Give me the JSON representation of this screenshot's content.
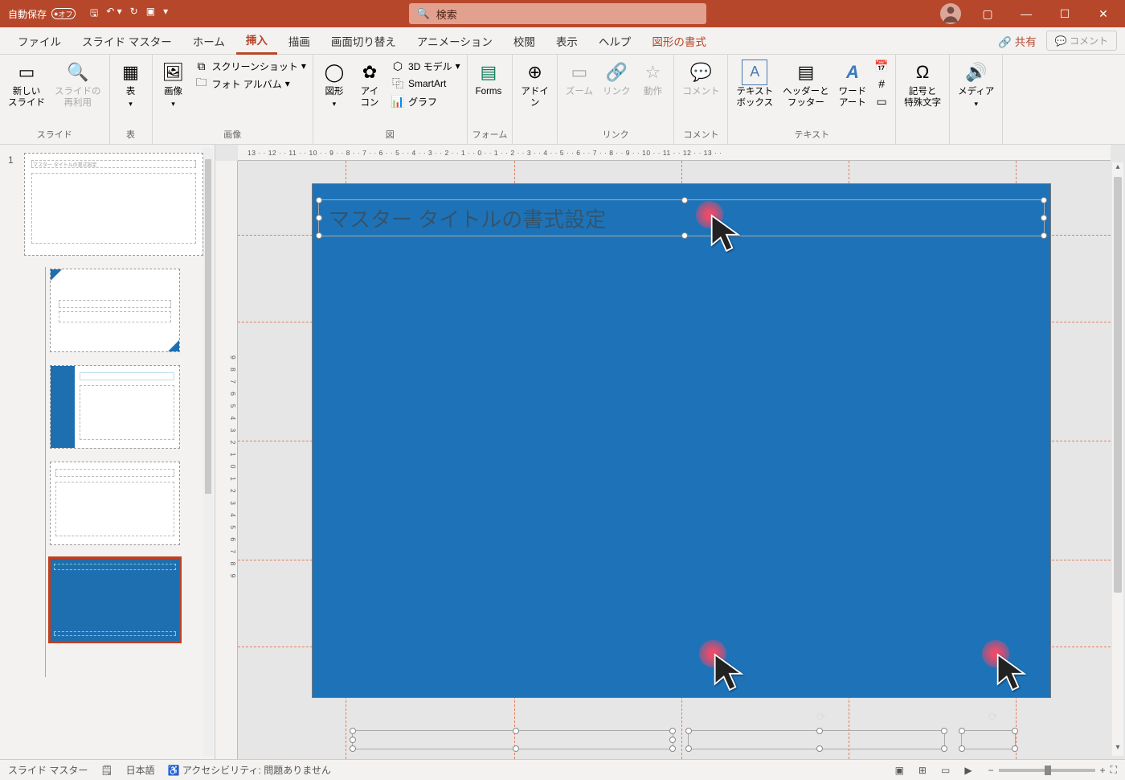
{
  "titlebar": {
    "autosave_label": "自動保存",
    "autosave_state": "オフ",
    "search_placeholder": "検索"
  },
  "tabs": {
    "file": "ファイル",
    "slidemaster": "スライド マスター",
    "home": "ホーム",
    "insert": "挿入",
    "draw": "描画",
    "transitions": "画面切り替え",
    "animations": "アニメーション",
    "review": "校閲",
    "view": "表示",
    "help": "ヘルプ",
    "shapeformat": "図形の書式",
    "share": "共有",
    "comments": "コメント"
  },
  "ribbon": {
    "group_slide": "スライド",
    "new_slide": "新しい\nスライド",
    "reuse_slide": "スライドの\n再利用",
    "group_table": "表",
    "table": "表",
    "group_image": "画像",
    "images": "画像",
    "screenshot": "スクリーンショット",
    "photo_album": "フォト アルバム",
    "group_illust": "図",
    "shapes": "図形",
    "icons": "アイ\nコン",
    "model3d": "3D モデル",
    "smartart": "SmartArt",
    "chart": "グラフ",
    "group_form": "フォーム",
    "forms": "Forms",
    "addin": "アドイ\nン",
    "group_link": "リンク",
    "zoom": "ズーム",
    "link": "リンク",
    "action": "動作",
    "group_comment": "コメント",
    "comment": "コメント",
    "group_text": "テキスト",
    "textbox": "テキスト\nボックス",
    "headerfooter": "ヘッダーと\nフッター",
    "wordart": "ワード\nアート",
    "group_symbol": "記号と\n特殊文字",
    "symbol": "記号と\n特殊文字",
    "group_media": "メディア",
    "media": "メディア"
  },
  "ruler": {
    "horizontal": "13 · · 12 · · 11 · · 10 · · 9 · · 8 · · 7 · · 6 · · 5 · · 4 · · 3 · · 2 · · 1 · · 0 · · 1 · · 2 · · 3 · · 4 · · 5 · · 6 · · 7 · · 8 · · 9 · · 10 · · 11 · · 12 · · 13 · ·",
    "vertical": "9 8 7 6 5 4 3 2 1 0 1 2 3 4 5 6 7 8 9"
  },
  "placeholder": {
    "title": "マスター タイトルの書式設定"
  },
  "status": {
    "mode": "スライド マスター",
    "lang": "日本語",
    "accessibility": "アクセシビリティ: 問題ありません"
  },
  "thumbs": {
    "num1": "1",
    "master_text": "マスター タイトルの書式設定",
    "layout_text": "マスター タイトルの書式設定"
  }
}
